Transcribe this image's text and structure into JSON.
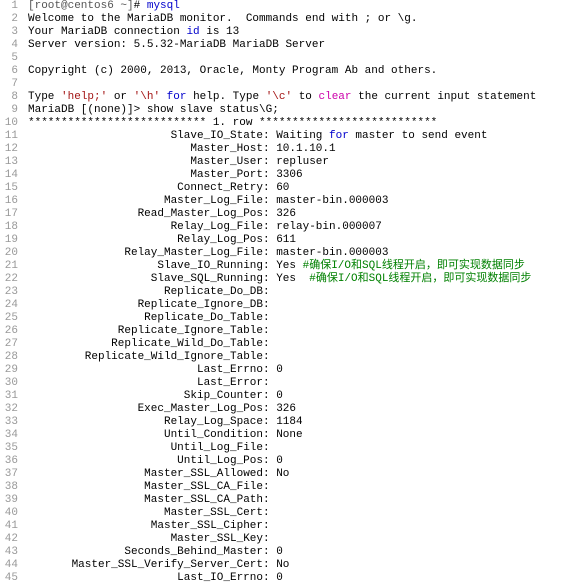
{
  "prompt": "[root@centos6 ~]",
  "hash": "#",
  "cmd": "mysql",
  "welcome": "Welcome to the MariaDB monitor.  Commands end with ; or \\g.",
  "conn_prefix": "Your MariaDB connection ",
  "conn_id_kw": "id",
  "conn_suffix": " is 13",
  "version": "Server version: 5.5.32-MariaDB MariaDB Server",
  "copyright": "Copyright (c) 2000, 2013, Oracle, Monty Program Ab and others.",
  "help": {
    "t1": "Type ",
    "s1": "'help;'",
    "t2": " or ",
    "s2": "'\\h'",
    "t3": " ",
    "k1": "for",
    "t4": " help. Type ",
    "s3": "'\\c'",
    "t5": " to ",
    "k2": "clear",
    "t6": " the current input statement"
  },
  "maria_prompt": "MariaDB [(none)]> show slave status\\G;",
  "rowheader": "*************************** 1. row ***************************",
  "for_kw": "for",
  "comment1": "#确保I/O和SQL线程开启，即可实现数据同步",
  "comment2": "#确保I/O和SQL线程开启，即可实现数据同步",
  "fields": [
    {
      "label": "Slave_IO_State",
      "value_pre": "Waiting ",
      "value_post": " master to send event",
      "has_for": true
    },
    {
      "label": "Master_Host",
      "value": "10.1.10.1"
    },
    {
      "label": "Master_User",
      "value": "repluser"
    },
    {
      "label": "Master_Port",
      "value": "3306"
    },
    {
      "label": "Connect_Retry",
      "value": "60"
    },
    {
      "label": "Master_Log_File",
      "value": "master-bin.000003"
    },
    {
      "label": "Read_Master_Log_Pos",
      "value": "326"
    },
    {
      "label": "Relay_Log_File",
      "value": "relay-bin.000007"
    },
    {
      "label": "Relay_Log_Pos",
      "value": "611"
    },
    {
      "label": "Relay_Master_Log_File",
      "value": "master-bin.000003"
    },
    {
      "label": "Slave_IO_Running",
      "value": "Yes ",
      "cmt": 1
    },
    {
      "label": "Slave_SQL_Running",
      "value": "Yes  ",
      "cmt": 2
    },
    {
      "label": "Replicate_Do_DB",
      "value": ""
    },
    {
      "label": "Replicate_Ignore_DB",
      "value": ""
    },
    {
      "label": "Replicate_Do_Table",
      "value": ""
    },
    {
      "label": "Replicate_Ignore_Table",
      "value": ""
    },
    {
      "label": "Replicate_Wild_Do_Table",
      "value": ""
    },
    {
      "label": "Replicate_Wild_Ignore_Table",
      "value": ""
    },
    {
      "label": "Last_Errno",
      "value": "0"
    },
    {
      "label": "Last_Error",
      "value": ""
    },
    {
      "label": "Skip_Counter",
      "value": "0"
    },
    {
      "label": "Exec_Master_Log_Pos",
      "value": "326"
    },
    {
      "label": "Relay_Log_Space",
      "value": "1184"
    },
    {
      "label": "Until_Condition",
      "value": "None"
    },
    {
      "label": "Until_Log_File",
      "value": ""
    },
    {
      "label": "Until_Log_Pos",
      "value": "0"
    },
    {
      "label": "Master_SSL_Allowed",
      "value": "No"
    },
    {
      "label": "Master_SSL_CA_File",
      "value": ""
    },
    {
      "label": "Master_SSL_CA_Path",
      "value": ""
    },
    {
      "label": "Master_SSL_Cert",
      "value": ""
    },
    {
      "label": "Master_SSL_Cipher",
      "value": ""
    },
    {
      "label": "Master_SSL_Key",
      "value": ""
    },
    {
      "label": "Seconds_Behind_Master",
      "value": "0"
    },
    {
      "label": "Master_SSL_Verify_Server_Cert",
      "value": "No"
    },
    {
      "label": "Last_IO_Errno",
      "value": "0"
    }
  ],
  "line_count": 45
}
